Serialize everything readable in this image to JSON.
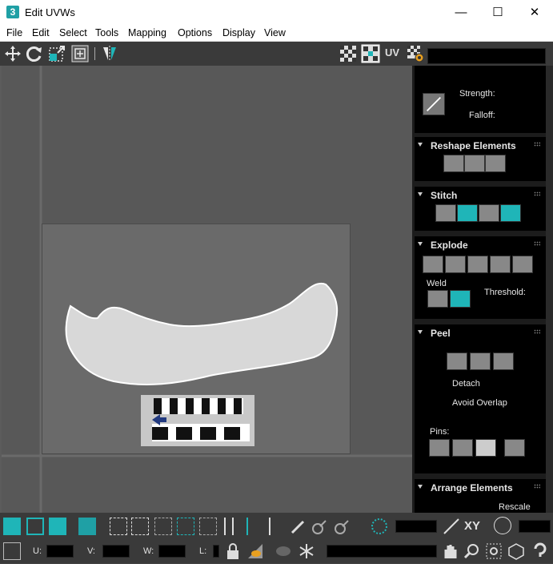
{
  "window": {
    "app_icon_glyph": "3",
    "title": "Edit UVWs",
    "minimize_glyph": "—",
    "maximize_glyph": "☐",
    "close_glyph": "✕"
  },
  "menu": [
    "File",
    "Edit",
    "Select",
    "Tools",
    "Mapping",
    "Options",
    "Display",
    "View"
  ],
  "toolbar": {
    "uv_label": "UV",
    "tools": [
      "move-icon",
      "rotate-icon",
      "scale-icon",
      "freeform-icon",
      "mirror-icon",
      "checker-off-icon",
      "checker-on-icon",
      "texture-settings-icon"
    ]
  },
  "panel": {
    "brush": {
      "strength_label": "Strength:",
      "falloff_label": "Falloff:"
    },
    "reshape": {
      "title": "Reshape Elements"
    },
    "stitch": {
      "title": "Stitch"
    },
    "explode": {
      "title": "Explode",
      "weld_label": "Weld",
      "threshold_label": "Threshold:"
    },
    "peel": {
      "title": "Peel",
      "detach_label": "Detach",
      "avoid_overlap_label": "Avoid Overlap",
      "pins_label": "Pins:"
    },
    "arrange": {
      "title": "Arrange Elements",
      "rescale_label": "Rescale"
    }
  },
  "bottom": {
    "xy_label": "XY",
    "u_label": "U:",
    "v_label": "V:",
    "w_label": "W:",
    "l_label": "L:"
  },
  "colors": {
    "accent": "#1fb5b8",
    "panel_bg": "#000000",
    "viewport_bg": "#585858"
  }
}
